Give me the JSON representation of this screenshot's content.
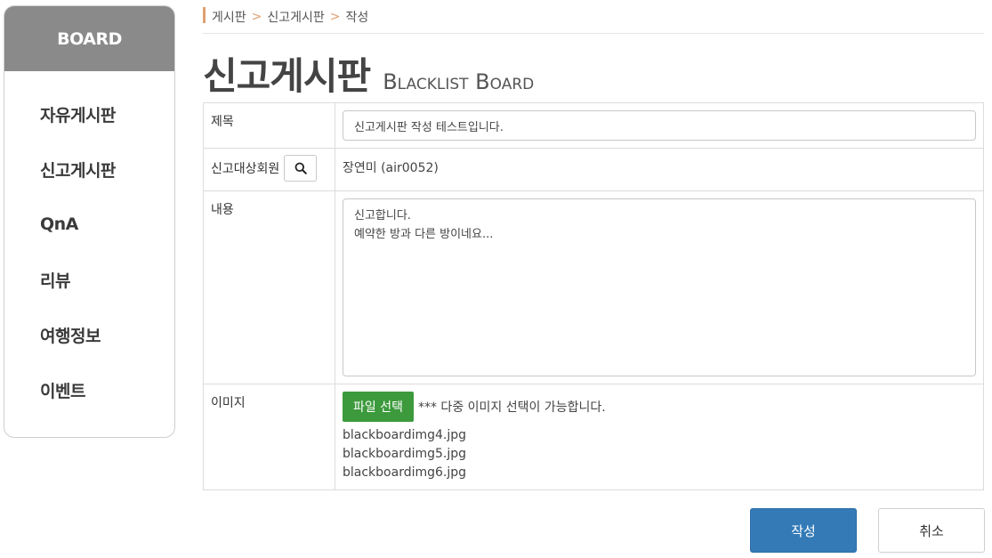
{
  "sidebar": {
    "header": "BOARD",
    "items": [
      {
        "label": "자유게시판"
      },
      {
        "label": "신고게시판"
      },
      {
        "label": "QnA"
      },
      {
        "label": "리뷰"
      },
      {
        "label": "여행정보"
      },
      {
        "label": "이벤트"
      }
    ]
  },
  "breadcrumb": [
    "게시판",
    "신고게시판",
    "작성"
  ],
  "page": {
    "title": "신고게시판",
    "subtitle": "Blacklist Board"
  },
  "form": {
    "title_label": "제목",
    "title_value": "신고게시판 작성 테스트입니다.",
    "target_label": "신고대상회원",
    "target_value": "장연미 (air0052)",
    "content_label": "내용",
    "content_value": "신고합니다.\n예약한 방과 다른 방이네요...",
    "image_label": "이미지",
    "file_button": "파일 선택",
    "file_note": "*** 다중 이미지 선택이 가능합니다.",
    "files": [
      "blackboardimg4.jpg",
      "blackboardimg5.jpg",
      "blackboardimg6.jpg"
    ]
  },
  "actions": {
    "submit_label": "작성",
    "cancel_label": "취소"
  },
  "colors": {
    "sidebar_header_bg": "#8a8a8a",
    "breadcrumb_accent": "#e0a070",
    "file_button_bg": "#3c9a3c",
    "submit_bg": "#337ab7"
  }
}
